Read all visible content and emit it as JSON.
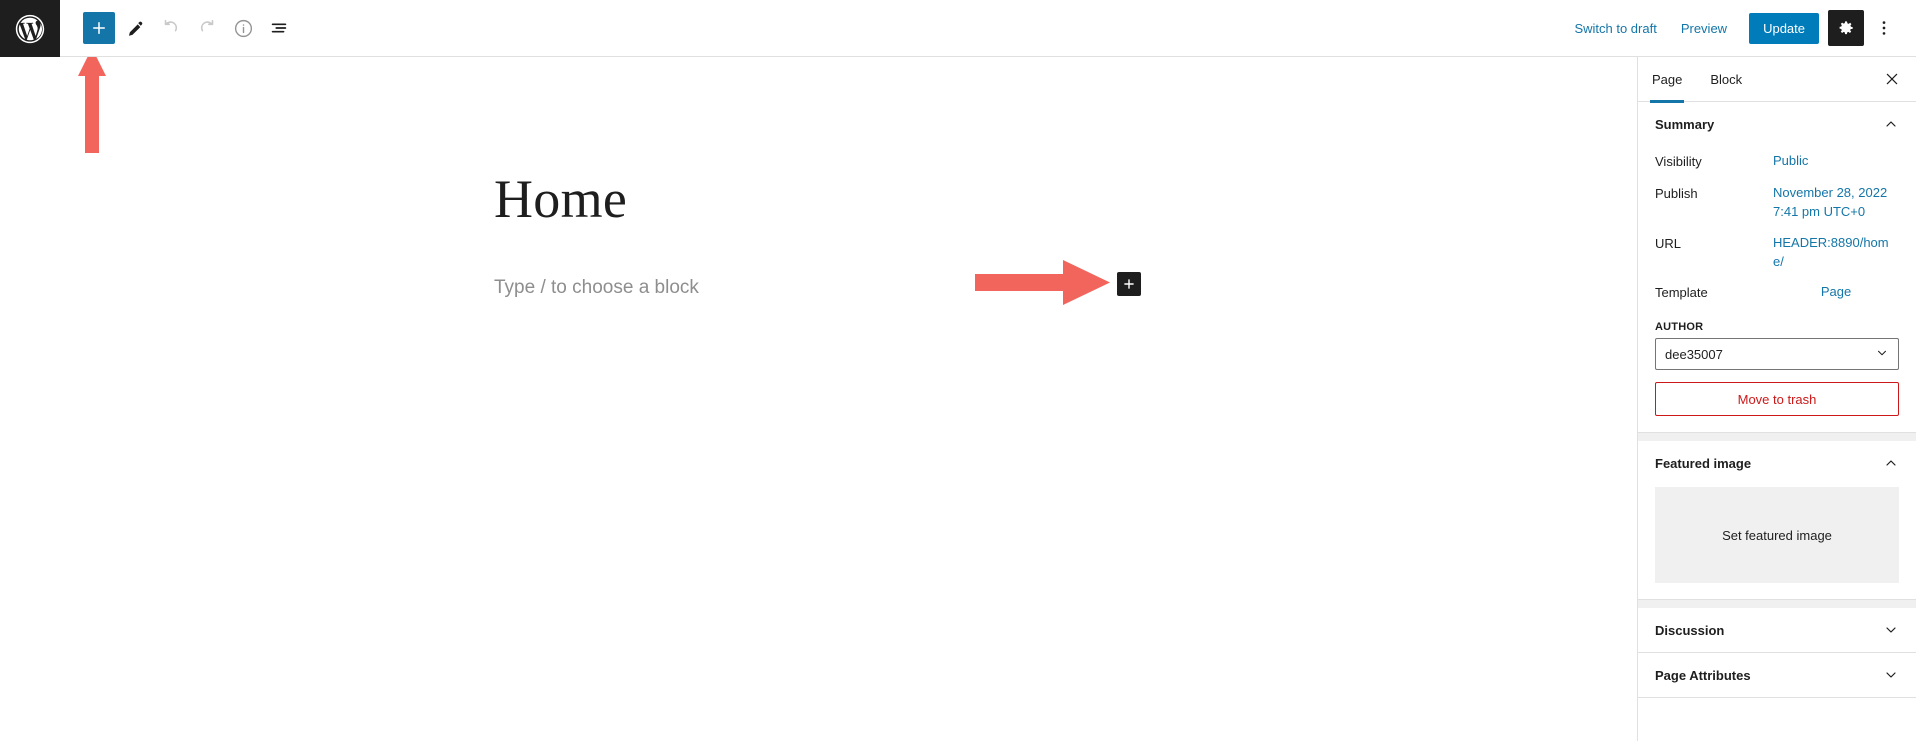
{
  "header": {
    "logo_icon": "wordpress-logo-icon",
    "left_tools": [
      {
        "name": "block-inserter-button",
        "icon": "plus-icon",
        "state": "active",
        "label": "+"
      },
      {
        "name": "edit-tool-button",
        "icon": "pencil-icon",
        "state": "enabled",
        "label": ""
      },
      {
        "name": "undo-button",
        "icon": "undo-icon",
        "state": "disabled",
        "label": ""
      },
      {
        "name": "redo-button",
        "icon": "redo-icon",
        "state": "disabled",
        "label": ""
      },
      {
        "name": "details-button",
        "icon": "info-circle-icon",
        "state": "enabled",
        "label": ""
      },
      {
        "name": "list-view-button",
        "icon": "list-view-icon",
        "state": "enabled",
        "label": ""
      }
    ],
    "switch_to_draft_label": "Switch to draft",
    "preview_label": "Preview",
    "update_label": "Update",
    "settings_icon": "gear-icon",
    "more_options_icon": "three-dots-vertical-icon"
  },
  "editor": {
    "title": "Home",
    "block_placeholder": "Type / to choose a block",
    "inserter_label": "+"
  },
  "annotations": [
    {
      "name": "arrow-up-annotation",
      "direction": "up",
      "color": "#f2655c",
      "points_at": "block-inserter-button"
    },
    {
      "name": "arrow-right-annotation",
      "direction": "right",
      "color": "#f2655c",
      "points_at": "canvas-inserter-button"
    }
  ],
  "sidebar": {
    "tabs": [
      {
        "label": "Page",
        "active": true
      },
      {
        "label": "Block",
        "active": false
      }
    ],
    "close_icon": "close-icon",
    "summary": {
      "title": "Summary",
      "chevron": "chevron-up-icon",
      "rows": [
        {
          "label": "Visibility",
          "value": "Public"
        },
        {
          "label": "Publish",
          "value": "November 28, 2022 7:41 pm UTC+0"
        },
        {
          "label": "URL",
          "value": "HEADER:8890/home/"
        },
        {
          "label": "Template",
          "value": "Page"
        }
      ],
      "author_label": "AUTHOR",
      "author_value": "dee35007",
      "author_chevron": "chevron-down-icon",
      "trash_label": "Move to trash"
    },
    "featured_image": {
      "title": "Featured image",
      "chevron": "chevron-up-icon",
      "set_label": "Set featured image"
    },
    "discussion": {
      "title": "Discussion",
      "chevron": "chevron-down-icon"
    },
    "page_attributes": {
      "title": "Page Attributes",
      "chevron": "chevron-down-icon"
    }
  },
  "colors": {
    "accent_blue": "#007cba",
    "link_blue": "#1476a8",
    "annotation_red": "#f2655c",
    "dark": "#1e1e1e",
    "danger_red": "#cc1818"
  }
}
